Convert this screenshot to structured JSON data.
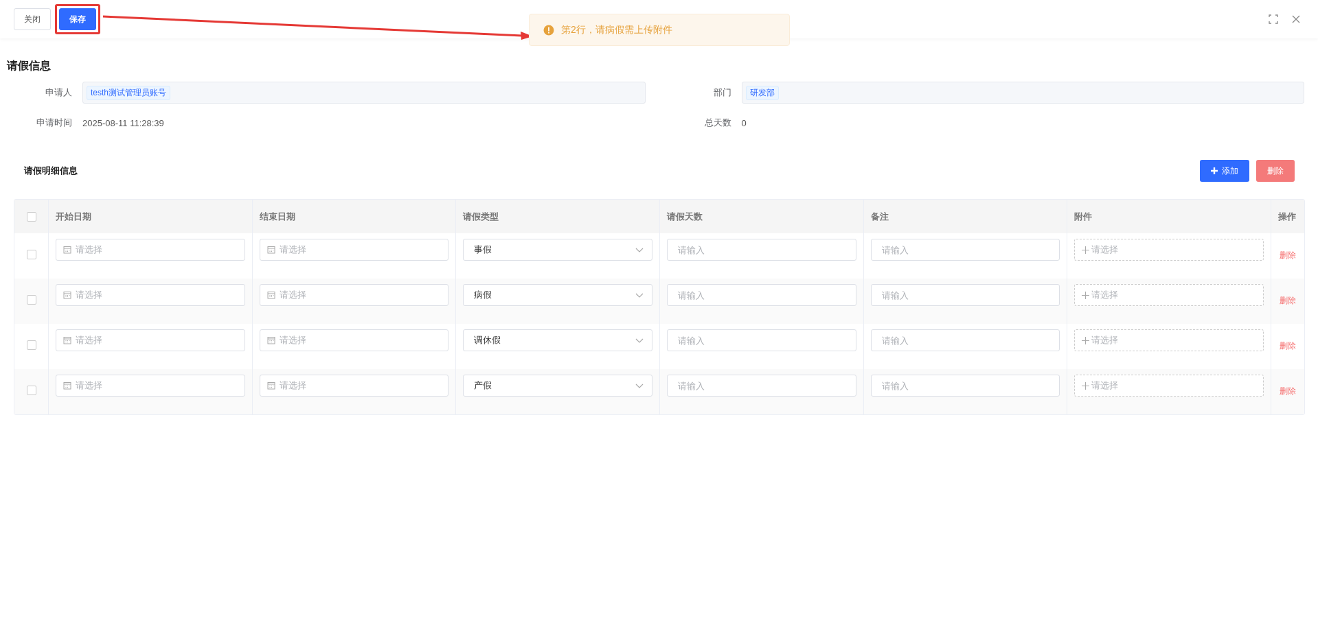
{
  "toolbar": {
    "buttons": [
      {
        "label": "关闭",
        "kind": "default"
      },
      {
        "label": "保存",
        "kind": "primary"
      }
    ]
  },
  "toast": {
    "kind": "warning",
    "message": "第2行，请病假需上传附件"
  },
  "leave_info": {
    "title": "请假信息",
    "fields": [
      {
        "label": "申请人",
        "kind": "tag",
        "value": "testh测试管理员账号"
      },
      {
        "label": "部门",
        "kind": "tag",
        "value": "研发部"
      },
      {
        "label": "申请时间",
        "kind": "text",
        "value": "2025-08-11 11:28:39"
      },
      {
        "label": "总天数",
        "kind": "text",
        "value": "0"
      }
    ]
  },
  "details": {
    "title": "请假明细信息",
    "add_button": "添加",
    "delete_button": "删除",
    "select_all_checked": false,
    "columns": [
      "开始日期",
      "结束日期",
      "请假类型",
      "请假天数",
      "备注",
      "附件",
      "操作"
    ],
    "rows": [
      {
        "checked": false,
        "start_date": {
          "placeholder": "请选择"
        },
        "end_date": {
          "placeholder": "请选择"
        },
        "leave_type": "事假",
        "days": {
          "placeholder": "请输入"
        },
        "note": {
          "placeholder": "请输入"
        },
        "attachment": {
          "placeholder": "请选择"
        },
        "action": "删除"
      },
      {
        "checked": false,
        "start_date": {
          "placeholder": "请选择"
        },
        "end_date": {
          "placeholder": "请选择"
        },
        "leave_type": "病假",
        "days": {
          "placeholder": "请输入"
        },
        "note": {
          "placeholder": "请输入"
        },
        "attachment": {
          "placeholder": "请选择"
        },
        "action": "删除"
      },
      {
        "checked": false,
        "start_date": {
          "placeholder": "请选择"
        },
        "end_date": {
          "placeholder": "请选择"
        },
        "leave_type": "调休假",
        "days": {
          "placeholder": "请输入"
        },
        "note": {
          "placeholder": "请输入"
        },
        "attachment": {
          "placeholder": "请选择"
        },
        "action": "删除"
      },
      {
        "checked": false,
        "start_date": {
          "placeholder": "请选择"
        },
        "end_date": {
          "placeholder": "请选择"
        },
        "leave_type": "产假",
        "days": {
          "placeholder": "请输入"
        },
        "note": {
          "placeholder": "请输入"
        },
        "attachment": {
          "placeholder": "请选择"
        },
        "action": "删除"
      }
    ]
  }
}
